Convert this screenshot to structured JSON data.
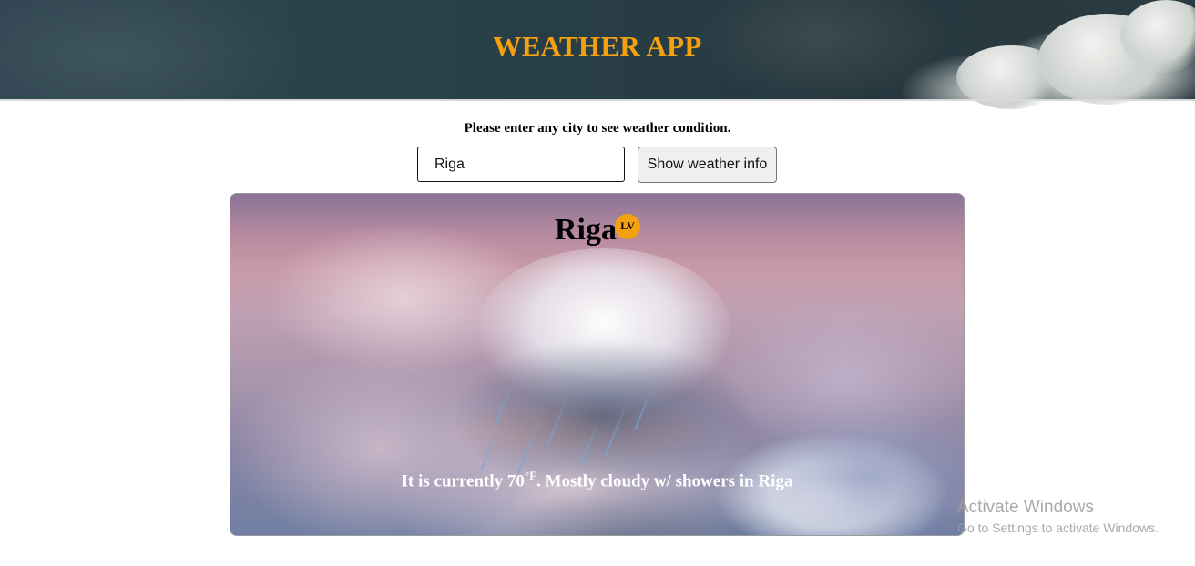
{
  "app": {
    "title": "WEATHER APP"
  },
  "search": {
    "prompt": "Please enter any city to see weather condition.",
    "value": "Riga",
    "button_label": "Show weather info"
  },
  "weather": {
    "city": "Riga",
    "country_code": "LV",
    "description_prefix": "It is currently ",
    "temperature": "70",
    "unit": "°F",
    "description_suffix": ". Mostly cloudy w/ showers in Riga"
  },
  "watermark": {
    "title": "Activate Windows",
    "subtitle": "Go to Settings to activate Windows."
  },
  "colors": {
    "accent": "#f5a00f",
    "header_bg": "#2a3d46"
  }
}
